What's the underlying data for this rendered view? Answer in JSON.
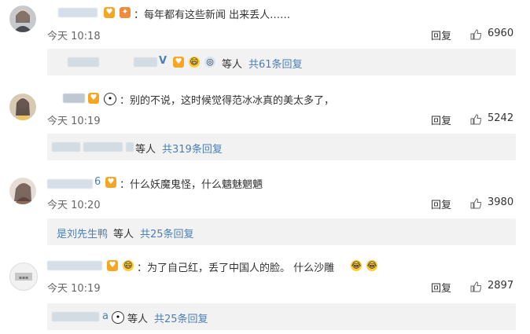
{
  "comments": [
    {
      "text": "：每年都有这些新闻 出来丢人……",
      "time": "今天 10:18",
      "reply": "回复",
      "likes": "6960",
      "sub": {
        "prefix": "",
        "etc": "等人",
        "count": "共61条回复",
        "vip": "V"
      }
    },
    {
      "text": "：别的不说，这时候觉得范冰冰真的美太多了，",
      "time": "今天 10:19",
      "reply": "回复",
      "likes": "5242",
      "sub": {
        "prefix": "",
        "etc": "等人",
        "count": "共319条回复"
      }
    },
    {
      "name_suffix": "6",
      "text": "：什么妖魔鬼怪，什么魑魅魍魉",
      "time": "今天 10:20",
      "reply": "回复",
      "likes": "3980",
      "sub": {
        "prefix": "是刘先生鸭",
        "etc": "等人",
        "count": "共25条回复"
      }
    },
    {
      "text": "：为了自己红，丢了中国人的脸。 什么沙雕",
      "time": "今天 10:19",
      "reply": "回复",
      "likes": "2897",
      "sub": {
        "prefix": "a",
        "etc": "等人",
        "count": "共25条回复"
      }
    }
  ],
  "colors": {
    "link": "#4a7fb5",
    "subbox_bg": "#f2f2f2",
    "text": "#333333",
    "time": "#666666"
  }
}
